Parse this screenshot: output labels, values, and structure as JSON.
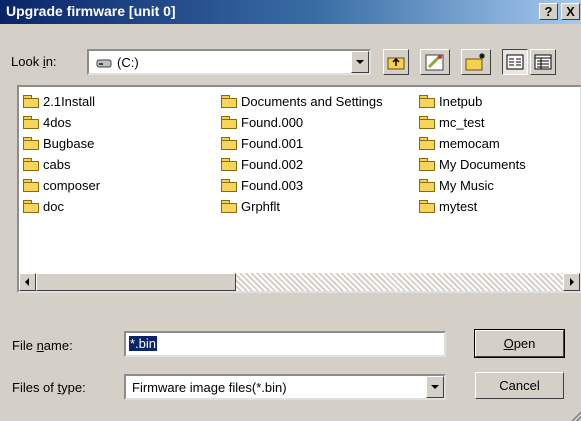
{
  "window": {
    "title": "Upgrade firmware [unit 0]",
    "help_button": "?",
    "close_button": "X"
  },
  "lookin": {
    "label_prefix": "Look ",
    "label_mnemonic": "i",
    "label_suffix": "n:",
    "value": "(C:)"
  },
  "toolbar": {
    "icons": [
      "up-one-level-icon",
      "create-shortcut-icon",
      "new-folder-icon",
      "list-view-icon",
      "details-view-icon"
    ]
  },
  "files": {
    "col1": [
      "2.1Install",
      "4dos",
      "Bugbase",
      "cabs",
      "composer",
      "doc"
    ],
    "col2": [
      "Documents and Settings",
      "Found.000",
      "Found.001",
      "Found.002",
      "Found.003",
      "Grphflt"
    ],
    "col3": [
      "Inetpub",
      "mc_test",
      "memocam",
      "My Documents",
      "My Music",
      "mytest"
    ]
  },
  "filename": {
    "label_prefix": "File ",
    "label_mnemonic": "n",
    "label_suffix": "ame:",
    "value": "*.bin"
  },
  "filetype": {
    "label_prefix": "Files of ",
    "label_mnemonic": "t",
    "label_suffix": "ype:",
    "value": "Firmware image files(*.bin)"
  },
  "buttons": {
    "open_mnemonic": "O",
    "open_suffix": "pen",
    "cancel_label": "Cancel"
  }
}
